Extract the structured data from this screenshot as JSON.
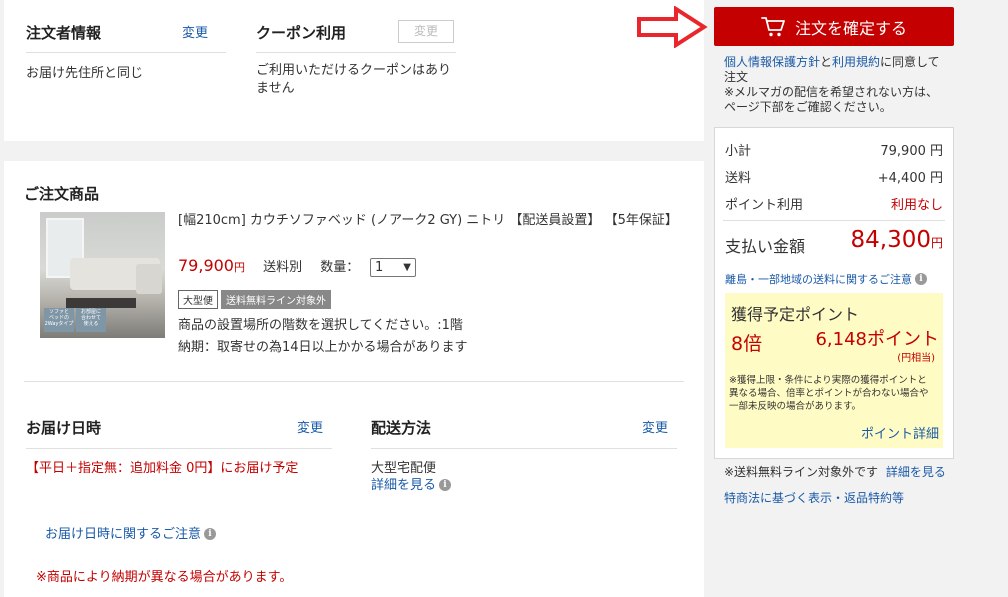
{
  "orderer": {
    "title": "注文者情報",
    "change": "変更",
    "value": "お届け先住所と同じ"
  },
  "coupon": {
    "title": "クーポン利用",
    "change": "変更",
    "text": "ご利用いただけるクーポンはありません"
  },
  "items": {
    "title": "ご注文商品",
    "product": {
      "name": "[幅210cm] カウチソファベッド (ノアーク2 GY) ニトリ 【配送員設置】 【5年保証】",
      "price": "79,900",
      "price_unit": "円",
      "shipping": "送料別",
      "qty_label": "数量：",
      "qty_value": "1",
      "tags": [
        "大型便",
        "送料無料ライン対象外"
      ],
      "note1": "商品の設置場所の階数を選択してください。:1階",
      "note2": "納期：取寄せの為14日以上かかる場合があります",
      "thumb_text": [
        "ソファと",
        "ベッドの",
        "2Wayタイプ",
        "お部屋に",
        "合わせて",
        "使える"
      ]
    }
  },
  "delivery_date": {
    "title": "お届け日時",
    "change": "変更",
    "value": "【平日＋指定無：追加料金 0円】にお届け予定",
    "notice_link": "お届け日時に関するご注意",
    "warning": "※商品により納期が異なる場合があります。"
  },
  "shipping_method": {
    "title": "配送方法",
    "change": "変更",
    "value": "大型宅配便",
    "detail_link": "詳細を見る"
  },
  "sidebar": {
    "confirm_button": "注文を確定する",
    "privacy_link": "個人情報保護方針",
    "and": "と",
    "terms_link": "利用規約",
    "agree_text_1": "に同意して",
    "agree_text_2": "注文",
    "mailmag_note_1": "※メルマガの配信を希望されない方は、",
    "mailmag_note_2": "ページ下部をご確認ください。",
    "summary": {
      "subtotal_label": "小計",
      "subtotal_value": "79,900 円",
      "shipping_label": "送料",
      "shipping_value": "+4,400 円",
      "point_label": "ポイント利用",
      "point_value": "利用なし",
      "total_label": "支払い金額",
      "total_value": "84,300",
      "total_unit": "円",
      "remote_link": "離島・一部地域の送料に関するご注意"
    },
    "points": {
      "title": "獲得予定ポイント",
      "multiplier": "8倍",
      "amount": "6,148ポイント",
      "yen_equiv": "(円相当)",
      "note_lines": [
        "※獲得上限・条件により実際の獲得ポイントと",
        "異なる場合、倍率とポイントが合わない場合や",
        "一部未反映の場合があります。"
      ],
      "detail_link": "ポイント詳細"
    },
    "free_shipping_note": "※送料無料ライン対象外です",
    "free_shipping_link": "詳細を見る",
    "legal_link": "特商法に基づく表示・返品特約等"
  },
  "colors": {
    "accent": "#c40000",
    "link": "#1a5aa8",
    "points_bg": "#fffbc4",
    "arrow": "#e8262b"
  }
}
